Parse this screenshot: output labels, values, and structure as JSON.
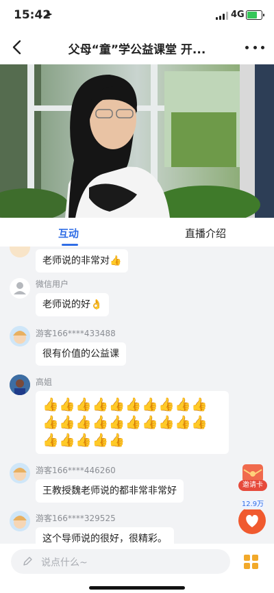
{
  "status_bar": {
    "time": "15:42",
    "network": "4G"
  },
  "nav": {
    "title": "父母“童”学公益课堂 开..."
  },
  "tabs": [
    {
      "label": "互动",
      "active": true
    },
    {
      "label": "直播介绍",
      "active": false
    }
  ],
  "messages": [
    {
      "user": "",
      "text": "老师说的非常对",
      "emoji": "👍",
      "avatar": "cartoon"
    },
    {
      "user": "微信用户",
      "text": "老师说的好",
      "emoji": "👌",
      "avatar": "default"
    },
    {
      "user": "游客166****433488",
      "text": "很有价值的公益课",
      "emoji": "",
      "avatar": "cartoon"
    },
    {
      "user": "高姐",
      "text": "👍👍👍👍👍👍👍👍👍👍👍👍👍👍👍👍👍👍👍👍👍👍👍👍👍",
      "emoji": "",
      "avatar": "photo"
    },
    {
      "user": "游客166****446260",
      "text": "王教授魏老师说的都非常非常好",
      "emoji": "",
      "avatar": "cartoon"
    },
    {
      "user": "游客166****329525",
      "text": "这个导师说的很好，很精彩。",
      "emoji": "",
      "avatar": "cartoon"
    }
  ],
  "floating": {
    "invite_label": "邀请卡",
    "likes_count": "12.9万"
  },
  "input": {
    "placeholder": "说点什么~"
  },
  "colors": {
    "accent": "#2f6de6",
    "like": "#f05a2f",
    "invite": "#e64a3b"
  }
}
